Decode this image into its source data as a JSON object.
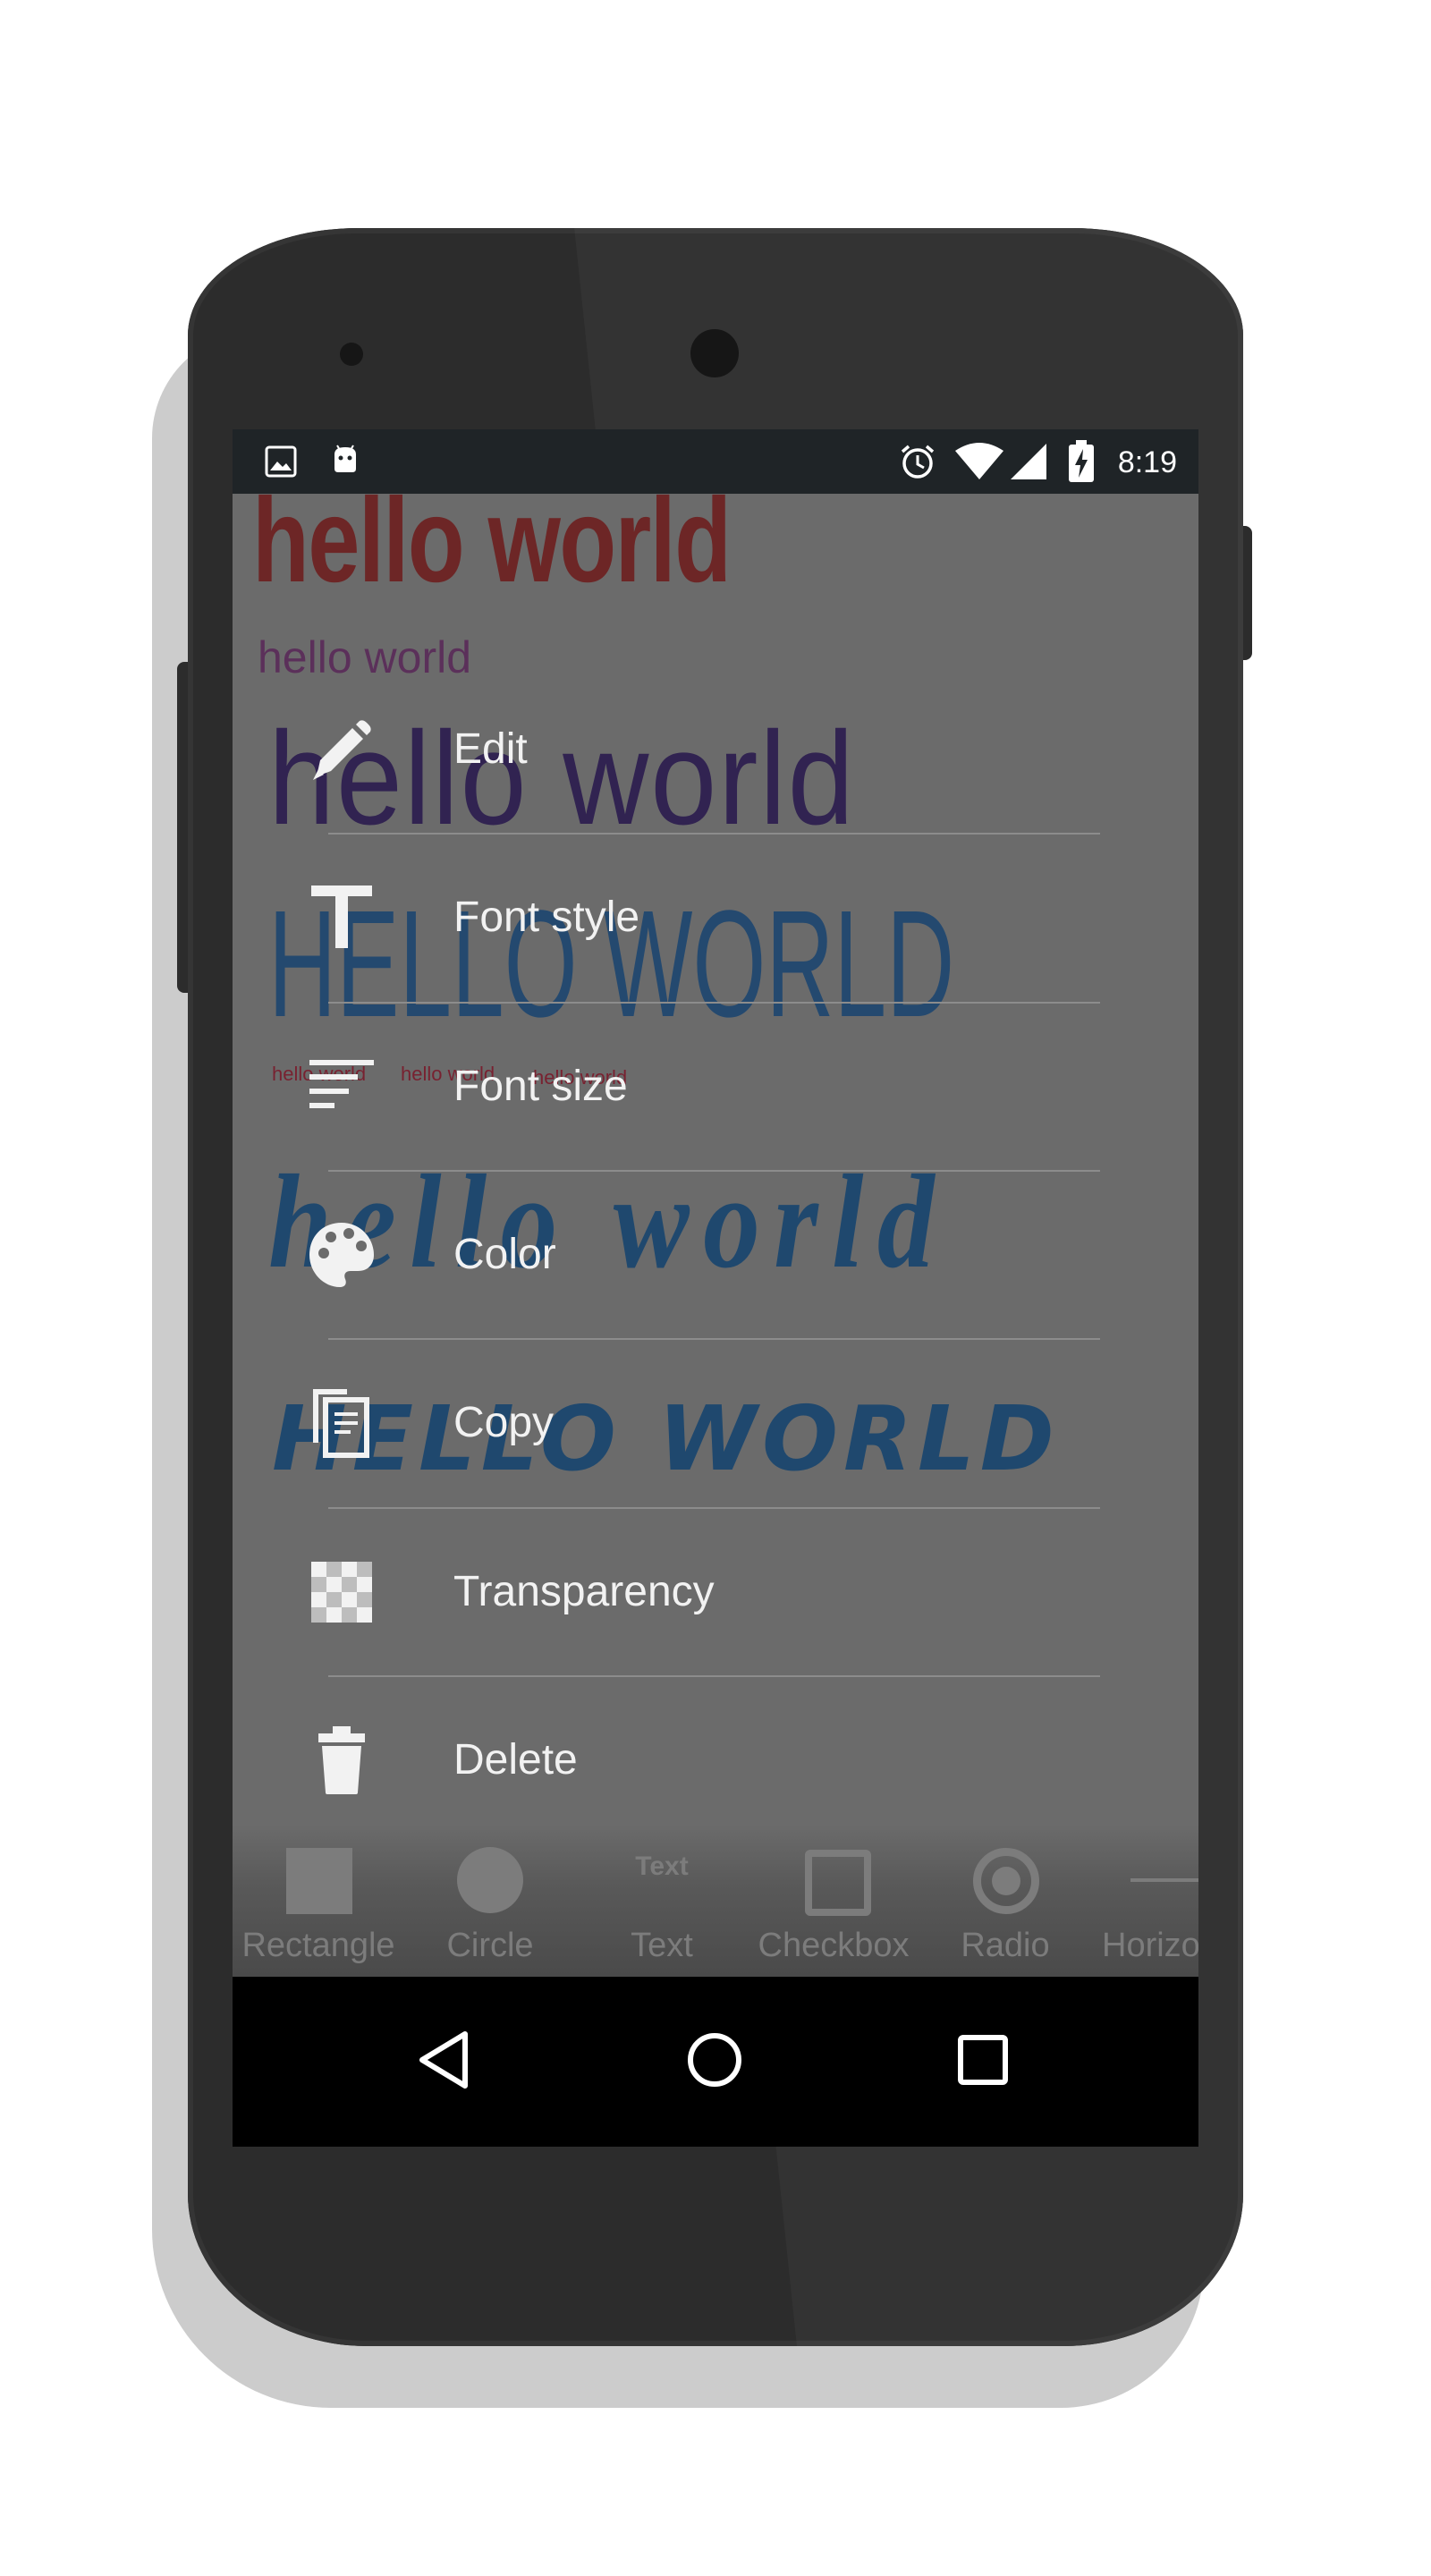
{
  "status_bar": {
    "time": "8:19",
    "left_icons": [
      "image-icon",
      "android-icon"
    ],
    "right_icons": [
      "alarm-icon",
      "wifi-icon",
      "signal-icon",
      "battery-charging-icon"
    ]
  },
  "canvas_samples": [
    {
      "text": "hello world",
      "color": "#6e1f1f"
    },
    {
      "text": "hello world",
      "color": "#5a2a59"
    },
    {
      "text": "hello world",
      "color": "#2b1c4f"
    },
    {
      "text": "HELLO WORLD",
      "color": "#1d4670"
    },
    {
      "text": "hello world",
      "color": "#7a1a2a"
    },
    {
      "text": "hello world",
      "color": "#7a1a2a"
    },
    {
      "text": "hello world",
      "color": "#7a1a2a"
    },
    {
      "text": "hello world",
      "color": "#17456f"
    },
    {
      "text": "HELLO WORLD",
      "color": "#17456f"
    }
  ],
  "context_menu": {
    "items": [
      {
        "label": "Edit",
        "icon": "pencil-icon"
      },
      {
        "label": "Font style",
        "icon": "text-icon"
      },
      {
        "label": "Font size",
        "icon": "format-lines-icon"
      },
      {
        "label": "Color",
        "icon": "palette-icon"
      },
      {
        "label": "Copy",
        "icon": "copy-icon"
      },
      {
        "label": "Transparency",
        "icon": "checkerboard-icon"
      },
      {
        "label": "Delete",
        "icon": "trash-icon"
      }
    ]
  },
  "toolbar": {
    "items": [
      {
        "label": "Rectangle",
        "icon": "rectangle-icon"
      },
      {
        "label": "Circle",
        "icon": "circle-icon"
      },
      {
        "label": "Text",
        "icon": "text-preview-icon",
        "preview": "Text"
      },
      {
        "label": "Checkbox",
        "icon": "checkbox-icon"
      },
      {
        "label": "Radio",
        "icon": "radio-icon"
      },
      {
        "label": "Horizo",
        "icon": "horizontal-line-icon"
      }
    ]
  },
  "nav_bar": {
    "buttons": [
      "back-icon",
      "home-icon",
      "recents-icon"
    ]
  },
  "colors": {
    "scrim": "#6b6b6b",
    "menu_text": "#f2f2f2",
    "divider": "#8c8c8c",
    "status_bar": "#1f2427",
    "nav_bar": "#000000",
    "phone_body": "#2c2c2c"
  }
}
